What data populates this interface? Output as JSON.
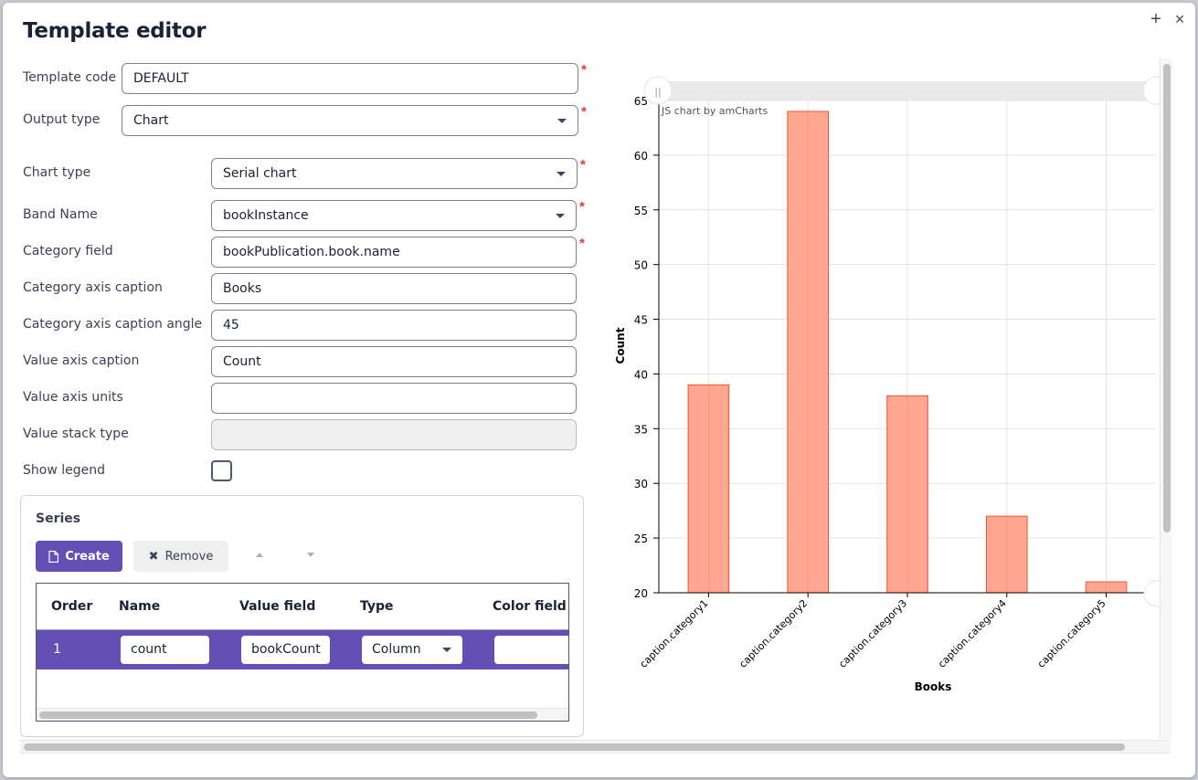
{
  "dialog": {
    "title": "Template editor",
    "maximize_icon": "+",
    "close_icon": "×"
  },
  "form": {
    "template_code": {
      "label": "Template code",
      "value": "DEFAULT",
      "required": true
    },
    "output_type": {
      "label": "Output type",
      "value": "Chart",
      "required": true
    },
    "chart_type": {
      "label": "Chart type",
      "value": "Serial chart",
      "required": true
    },
    "band_name": {
      "label": "Band Name",
      "value": "bookInstance",
      "required": true
    },
    "category_field": {
      "label": "Category field",
      "value": "bookPublication.book.name",
      "required": true
    },
    "category_axis_caption": {
      "label": "Category axis caption",
      "value": "Books"
    },
    "category_axis_caption_angle": {
      "label": "Category axis caption angle",
      "value": "45"
    },
    "value_axis_caption": {
      "label": "Value axis caption",
      "value": "Count"
    },
    "value_axis_units": {
      "label": "Value axis units",
      "value": ""
    },
    "value_stack_type": {
      "label": "Value stack type",
      "value": ""
    },
    "show_legend": {
      "label": "Show legend",
      "checked": false
    },
    "required_marker": "*"
  },
  "series": {
    "title": "Series",
    "create_label": "Create",
    "remove_label": "Remove",
    "columns": [
      "Order",
      "Name",
      "Value field",
      "Type",
      "Color field"
    ],
    "rows": [
      {
        "order": "1",
        "name": "count",
        "value_field": "bookCount",
        "type": "Column",
        "color_field": ""
      }
    ]
  },
  "chart_data": {
    "type": "bar",
    "title": "",
    "watermark": "JS chart by amCharts",
    "xlabel": "Books",
    "ylabel": "Count",
    "categories": [
      "caption.category1",
      "caption.category2",
      "caption.category3",
      "caption.category4",
      "caption.category5"
    ],
    "values": [
      39,
      64,
      38,
      27,
      21
    ],
    "ylim": [
      20,
      65
    ],
    "yticks": [
      20,
      25,
      30,
      35,
      40,
      45,
      50,
      55,
      60,
      65
    ],
    "xlabel_angle": 45,
    "grid": true,
    "legend": "none",
    "bar_fill": "#ffa28a",
    "bar_stroke": "#f0562f"
  },
  "colors": {
    "accent": "#6450b5",
    "required": "#e53935"
  }
}
